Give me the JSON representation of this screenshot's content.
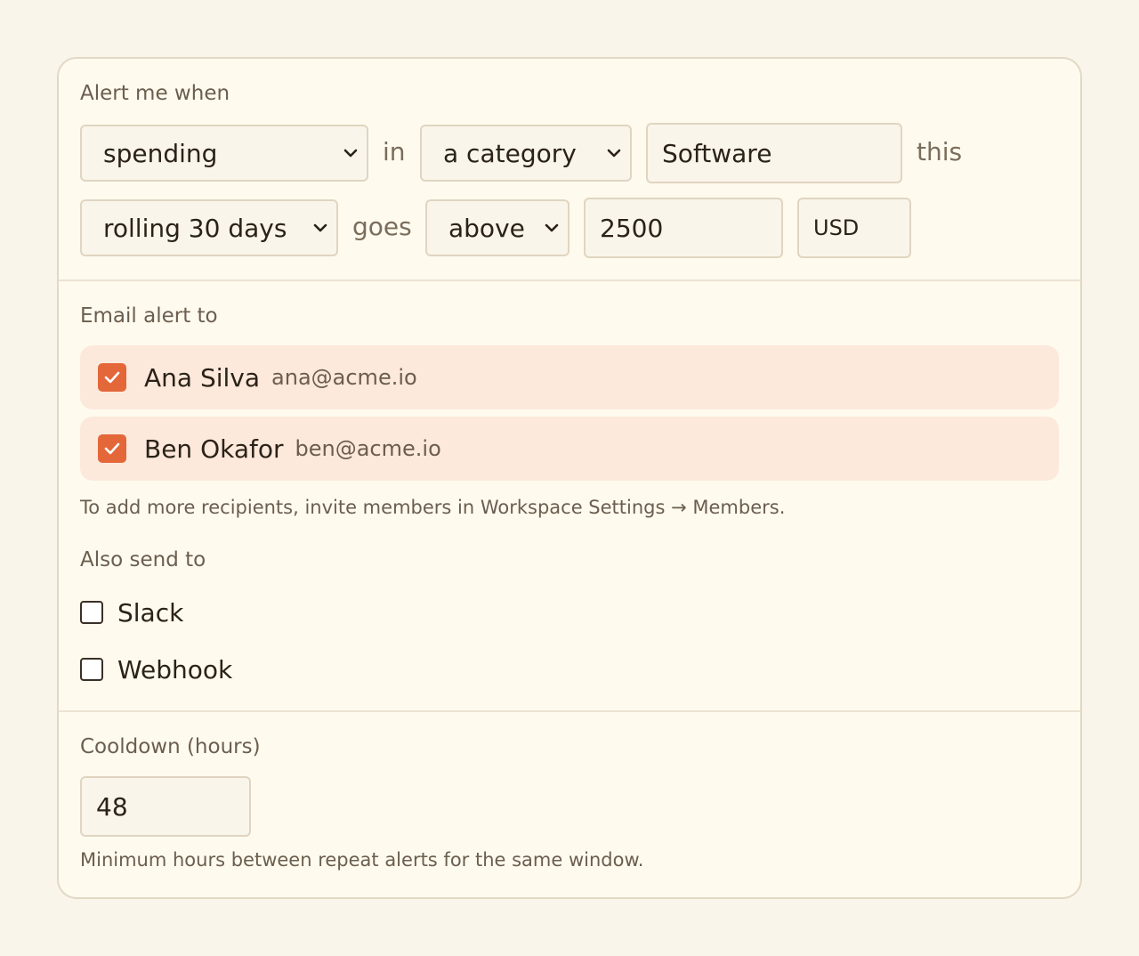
{
  "condition": {
    "heading": "Alert me when",
    "metric_select": "spending",
    "word_in": "in",
    "scope_select": "a category",
    "category_value": "Software",
    "word_this": "this",
    "period_select": "rolling 30 days",
    "word_goes": "goes",
    "direction_select": "above",
    "amount_value": "2500",
    "currency": "USD"
  },
  "email": {
    "heading": "Email alert to",
    "recipients": [
      {
        "name": "Ana Silva",
        "email": "ana@acme.io",
        "checked": true
      },
      {
        "name": "Ben Okafor",
        "email": "ben@acme.io",
        "checked": true
      }
    ],
    "hint": "To add more recipients, invite members in Workspace Settings → Members."
  },
  "also": {
    "heading": "Also send to",
    "options": [
      {
        "label": "Slack",
        "checked": false
      },
      {
        "label": "Webhook",
        "checked": false
      }
    ]
  },
  "cooldown": {
    "heading": "Cooldown (hours)",
    "value": "48",
    "hint": "Minimum hours between repeat alerts for the same window."
  },
  "colors": {
    "accent": "#e4673a",
    "recipient_bg": "#fce9db",
    "page_bg": "#f9f5ea",
    "card_bg": "#fefaee"
  }
}
